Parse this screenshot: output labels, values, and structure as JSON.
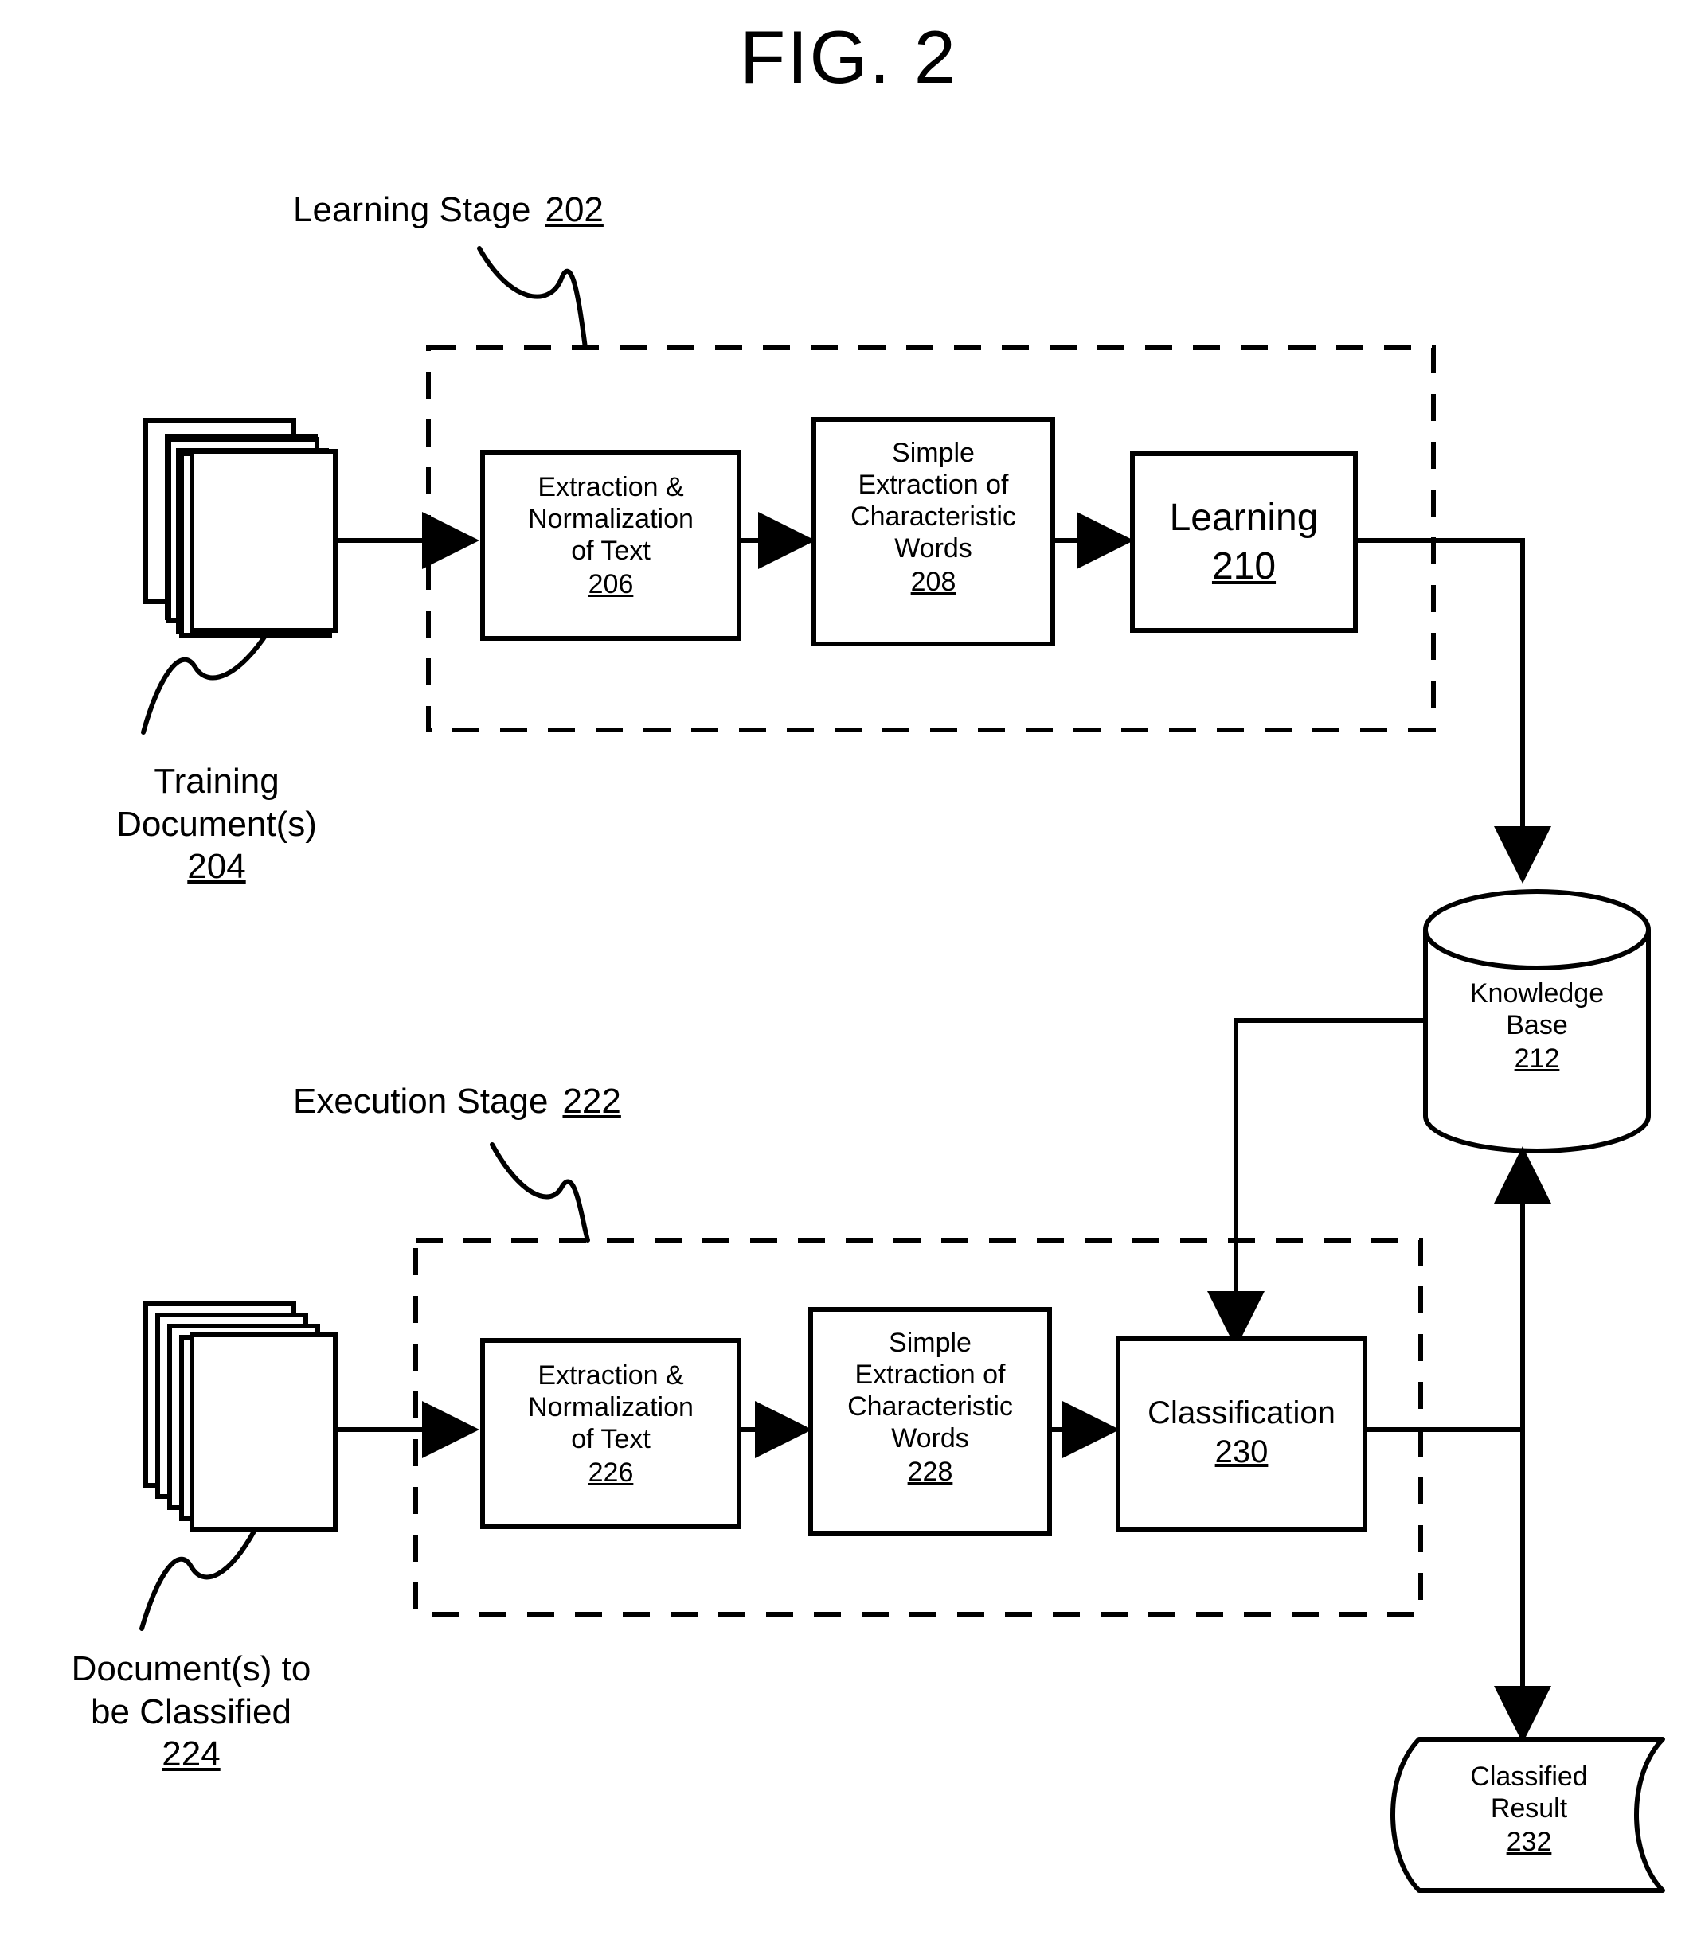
{
  "figure": {
    "title": "FIG. 2"
  },
  "stages": [
    {
      "name": "Learning Stage",
      "ref": "202"
    },
    {
      "name": "Execution Stage",
      "ref": "222"
    }
  ],
  "inputs": [
    {
      "label_line1": "Training",
      "label_line2": "Document(s)",
      "ref": "204",
      "icon": "document-stack-icon"
    },
    {
      "label_line1": "Document(s) to",
      "label_line2": "be Classified",
      "ref": "224",
      "icon": "document-stack-icon"
    }
  ],
  "learning_nodes": [
    {
      "line1": "Extraction &",
      "line2": "Normalization",
      "line3": "of Text",
      "ref": "206"
    },
    {
      "line1": "Simple",
      "line2": "Extraction of",
      "line3": "Characteristic",
      "line4": "Words",
      "ref": "208"
    },
    {
      "line1": "Learning",
      "ref": "210"
    }
  ],
  "execution_nodes": [
    {
      "line1": "Extraction &",
      "line2": "Normalization",
      "line3": "of Text",
      "ref": "226"
    },
    {
      "line1": "Simple",
      "line2": "Extraction of",
      "line3": "Characteristic",
      "line4": "Words",
      "ref": "228"
    },
    {
      "line1": "Classification",
      "ref": "230"
    }
  ],
  "stores": [
    {
      "shape": "cylinder",
      "line1": "Knowledge",
      "line2": "Base",
      "ref": "212"
    },
    {
      "shape": "tape",
      "line1": "Classified",
      "line2": "Result",
      "ref": "232"
    }
  ],
  "style": {
    "stroke": "#000000",
    "background": "#ffffff"
  }
}
